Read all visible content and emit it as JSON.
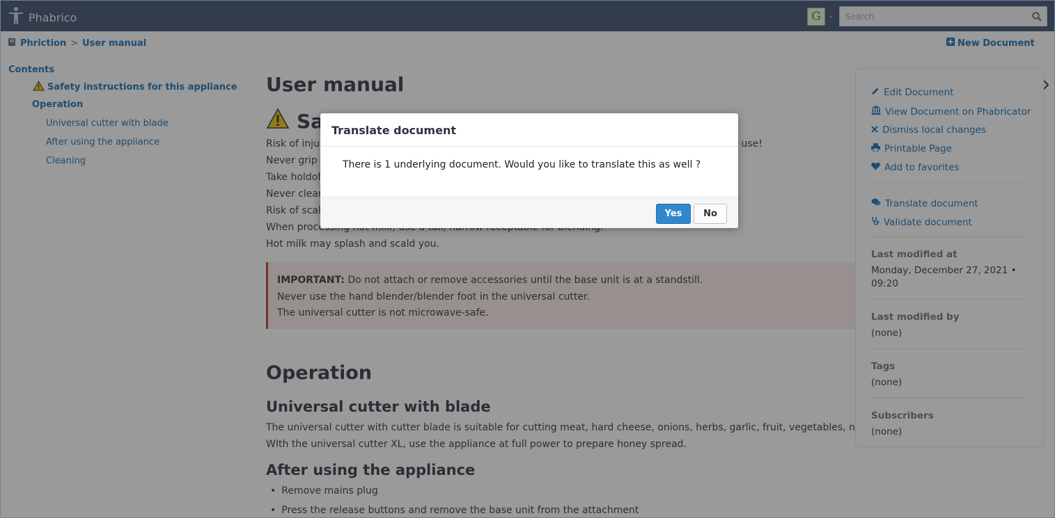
{
  "app": {
    "name": "Phabrico"
  },
  "header": {
    "avatar_letter": "G",
    "search_placeholder": "Search"
  },
  "breadcrumb": {
    "root": "Phriction",
    "separator": ">",
    "current": "User manual",
    "new_document": "New Document"
  },
  "toc": {
    "heading": "Contents",
    "items": [
      {
        "label": "Safety instructions for this appliance",
        "level": 1
      },
      {
        "label": "Operation",
        "level": 1
      },
      {
        "label": "Universal cutter with blade",
        "level": 2
      },
      {
        "label": "After using the appliance",
        "level": 2
      },
      {
        "label": "Cleaning",
        "level": 2
      }
    ]
  },
  "document": {
    "title": "User manual",
    "section1_heading_visible": "Sa",
    "lines": [
      "Risk of injur",
      "Never grip t",
      "Take holdof",
      "Never clean",
      "Risk of scalc",
      "When processing hot milk, use a tall, narrow receptable for blending.",
      "Hot milk may splash and scald you."
    ],
    "line1_tail": "re use!",
    "important_label": "IMPORTANT:",
    "important_lines": [
      "Do not attach or remove accessories until the base unit is at a standstill.",
      "Never use the hand blender/blender foot in the universal cutter.",
      "The universal cutter is not microwave-safe."
    ],
    "operation_heading": "Operation",
    "cutter_heading": "Universal cutter with blade",
    "cutter_lines": [
      "The universal cutter with cutter blade is suitable for cutting meat, hard cheese, onions, herbs, garlic, fruit, vegetables, nuts, almor",
      "WIth the universal cutter XL, use the appliance at full power to prepare honey spread."
    ],
    "after_heading": "After using the appliance",
    "after_items": [
      "Remove mains plug",
      "Press the release buttons and remove the base unit from the attachment"
    ]
  },
  "sidebar": {
    "actions": [
      {
        "label": "Edit Document",
        "icon": "pencil-icon"
      },
      {
        "label": "View Document on Phabricator",
        "icon": "bank-icon"
      },
      {
        "label": "Dismiss local changes",
        "icon": "x-icon"
      },
      {
        "label": "Printable Page",
        "icon": "printer-icon"
      },
      {
        "label": "Add to favorites",
        "icon": "heart-icon"
      }
    ],
    "actions2": [
      {
        "label": "Translate document",
        "icon": "comments-icon"
      },
      {
        "label": "Validate document",
        "icon": "stethoscope-icon"
      }
    ],
    "last_modified_at_label": "Last modified at",
    "last_modified_at_value": "Monday, December 27, 2021 • 09:20",
    "last_modified_by_label": "Last modified by",
    "last_modified_by_value": "(none)",
    "tags_label": "Tags",
    "tags_value": "(none)",
    "subscribers_label": "Subscribers",
    "subscribers_value": "(none)"
  },
  "dialog": {
    "title": "Translate document",
    "message": "There is 1 underlying document. Would you like to translate this as well ?",
    "yes": "Yes",
    "no": "No"
  },
  "colors": {
    "topbar": "#3d4f6e",
    "link": "#136cb2",
    "primary_button": "#2f88cc",
    "important_border": "#c0392b"
  }
}
